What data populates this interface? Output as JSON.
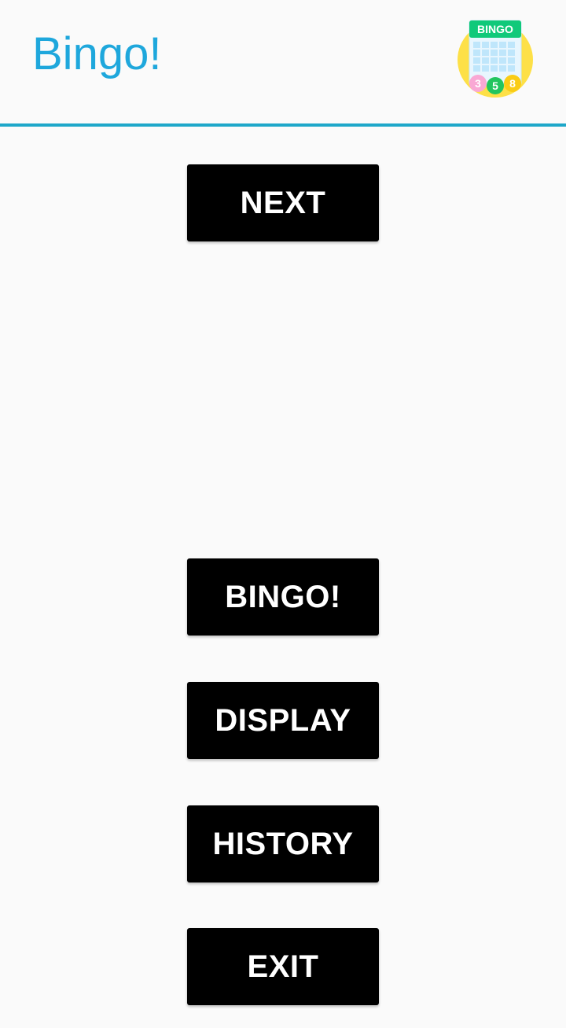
{
  "app_bar": {
    "title": "Bingo!",
    "logo": {
      "icon": "bingo-card-icon",
      "text": "BINGO",
      "balls": [
        "3",
        "5",
        "8"
      ],
      "colors": {
        "circle": "#fde047",
        "header": "#10c97a",
        "grid": "#bfe6fb",
        "ball_1": "#f472b6",
        "ball_2": "#22c55e",
        "ball_3": "#facc15"
      }
    }
  },
  "colors": {
    "accent": "#1ea7dc",
    "divider": "#1ea7c9",
    "button_bg": "#000000",
    "button_text": "#ffffff",
    "background": "#fafafa"
  },
  "buttons": {
    "next": "NEXT",
    "bingo": "BINGO!",
    "display": "DISPLAY",
    "history": "HISTORY",
    "exit": "EXIT"
  }
}
